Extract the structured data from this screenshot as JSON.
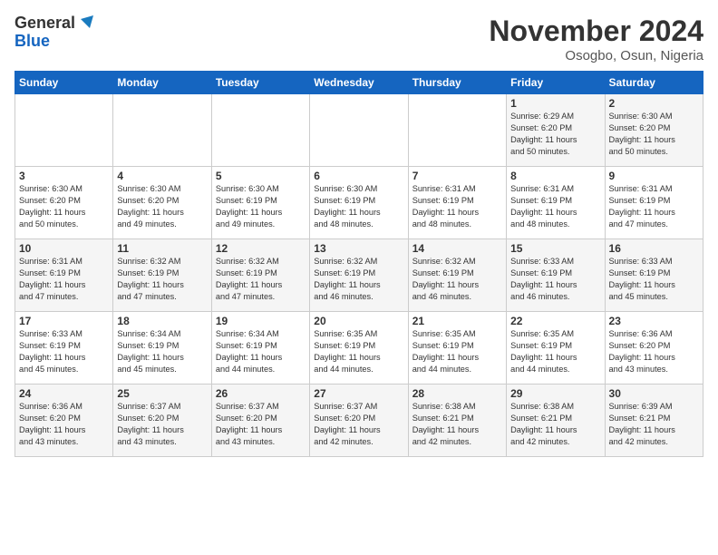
{
  "logo": {
    "general": "General",
    "blue": "Blue"
  },
  "header": {
    "month": "November 2024",
    "location": "Osogbo, Osun, Nigeria"
  },
  "weekdays": [
    "Sunday",
    "Monday",
    "Tuesday",
    "Wednesday",
    "Thursday",
    "Friday",
    "Saturday"
  ],
  "weeks": [
    [
      {
        "day": "",
        "info": ""
      },
      {
        "day": "",
        "info": ""
      },
      {
        "day": "",
        "info": ""
      },
      {
        "day": "",
        "info": ""
      },
      {
        "day": "",
        "info": ""
      },
      {
        "day": "1",
        "info": "Sunrise: 6:29 AM\nSunset: 6:20 PM\nDaylight: 11 hours\nand 50 minutes."
      },
      {
        "day": "2",
        "info": "Sunrise: 6:30 AM\nSunset: 6:20 PM\nDaylight: 11 hours\nand 50 minutes."
      }
    ],
    [
      {
        "day": "3",
        "info": "Sunrise: 6:30 AM\nSunset: 6:20 PM\nDaylight: 11 hours\nand 50 minutes."
      },
      {
        "day": "4",
        "info": "Sunrise: 6:30 AM\nSunset: 6:20 PM\nDaylight: 11 hours\nand 49 minutes."
      },
      {
        "day": "5",
        "info": "Sunrise: 6:30 AM\nSunset: 6:19 PM\nDaylight: 11 hours\nand 49 minutes."
      },
      {
        "day": "6",
        "info": "Sunrise: 6:30 AM\nSunset: 6:19 PM\nDaylight: 11 hours\nand 48 minutes."
      },
      {
        "day": "7",
        "info": "Sunrise: 6:31 AM\nSunset: 6:19 PM\nDaylight: 11 hours\nand 48 minutes."
      },
      {
        "day": "8",
        "info": "Sunrise: 6:31 AM\nSunset: 6:19 PM\nDaylight: 11 hours\nand 48 minutes."
      },
      {
        "day": "9",
        "info": "Sunrise: 6:31 AM\nSunset: 6:19 PM\nDaylight: 11 hours\nand 47 minutes."
      }
    ],
    [
      {
        "day": "10",
        "info": "Sunrise: 6:31 AM\nSunset: 6:19 PM\nDaylight: 11 hours\nand 47 minutes."
      },
      {
        "day": "11",
        "info": "Sunrise: 6:32 AM\nSunset: 6:19 PM\nDaylight: 11 hours\nand 47 minutes."
      },
      {
        "day": "12",
        "info": "Sunrise: 6:32 AM\nSunset: 6:19 PM\nDaylight: 11 hours\nand 47 minutes."
      },
      {
        "day": "13",
        "info": "Sunrise: 6:32 AM\nSunset: 6:19 PM\nDaylight: 11 hours\nand 46 minutes."
      },
      {
        "day": "14",
        "info": "Sunrise: 6:32 AM\nSunset: 6:19 PM\nDaylight: 11 hours\nand 46 minutes."
      },
      {
        "day": "15",
        "info": "Sunrise: 6:33 AM\nSunset: 6:19 PM\nDaylight: 11 hours\nand 46 minutes."
      },
      {
        "day": "16",
        "info": "Sunrise: 6:33 AM\nSunset: 6:19 PM\nDaylight: 11 hours\nand 45 minutes."
      }
    ],
    [
      {
        "day": "17",
        "info": "Sunrise: 6:33 AM\nSunset: 6:19 PM\nDaylight: 11 hours\nand 45 minutes."
      },
      {
        "day": "18",
        "info": "Sunrise: 6:34 AM\nSunset: 6:19 PM\nDaylight: 11 hours\nand 45 minutes."
      },
      {
        "day": "19",
        "info": "Sunrise: 6:34 AM\nSunset: 6:19 PM\nDaylight: 11 hours\nand 44 minutes."
      },
      {
        "day": "20",
        "info": "Sunrise: 6:35 AM\nSunset: 6:19 PM\nDaylight: 11 hours\nand 44 minutes."
      },
      {
        "day": "21",
        "info": "Sunrise: 6:35 AM\nSunset: 6:19 PM\nDaylight: 11 hours\nand 44 minutes."
      },
      {
        "day": "22",
        "info": "Sunrise: 6:35 AM\nSunset: 6:19 PM\nDaylight: 11 hours\nand 44 minutes."
      },
      {
        "day": "23",
        "info": "Sunrise: 6:36 AM\nSunset: 6:20 PM\nDaylight: 11 hours\nand 43 minutes."
      }
    ],
    [
      {
        "day": "24",
        "info": "Sunrise: 6:36 AM\nSunset: 6:20 PM\nDaylight: 11 hours\nand 43 minutes."
      },
      {
        "day": "25",
        "info": "Sunrise: 6:37 AM\nSunset: 6:20 PM\nDaylight: 11 hours\nand 43 minutes."
      },
      {
        "day": "26",
        "info": "Sunrise: 6:37 AM\nSunset: 6:20 PM\nDaylight: 11 hours\nand 43 minutes."
      },
      {
        "day": "27",
        "info": "Sunrise: 6:37 AM\nSunset: 6:20 PM\nDaylight: 11 hours\nand 42 minutes."
      },
      {
        "day": "28",
        "info": "Sunrise: 6:38 AM\nSunset: 6:21 PM\nDaylight: 11 hours\nand 42 minutes."
      },
      {
        "day": "29",
        "info": "Sunrise: 6:38 AM\nSunset: 6:21 PM\nDaylight: 11 hours\nand 42 minutes."
      },
      {
        "day": "30",
        "info": "Sunrise: 6:39 AM\nSunset: 6:21 PM\nDaylight: 11 hours\nand 42 minutes."
      }
    ]
  ]
}
